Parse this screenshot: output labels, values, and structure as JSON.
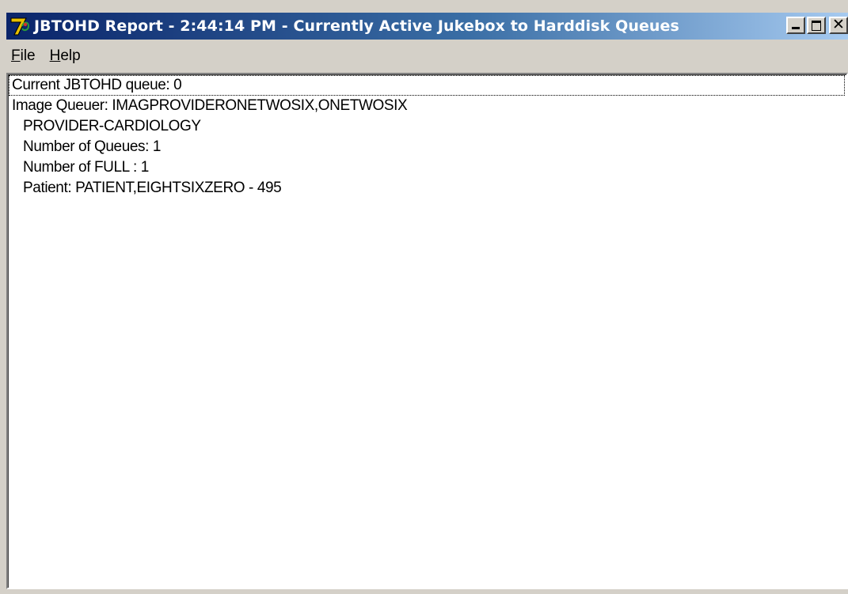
{
  "window": {
    "title": "JBTOHD Report - 2:44:14 PM - Currently Active Jukebox to Harddisk Queues",
    "icon": "app-7-icon",
    "controls": {
      "minimize": "minimize-icon",
      "maximize": "maximize-icon",
      "close_glyph": "✕"
    }
  },
  "menu": {
    "items": [
      {
        "label": "File",
        "mnemonic": "F",
        "rest": "ile"
      },
      {
        "label": "Help",
        "mnemonic": "H",
        "rest": "elp"
      }
    ]
  },
  "report": {
    "lines": [
      {
        "text": "Current JBTOHD queue: 0",
        "indent": false,
        "selected": true
      },
      {
        "text": "Image Queuer: IMAGPROVIDERONETWOSIX,ONETWOSIX",
        "indent": false,
        "selected": false
      },
      {
        "text": "PROVIDER-CARDIOLOGY",
        "indent": true,
        "selected": false
      },
      {
        "text": "Number of Queues: 1",
        "indent": true,
        "selected": false
      },
      {
        "text": "Number of FULL : 1",
        "indent": true,
        "selected": false
      },
      {
        "text": "Patient: PATIENT,EIGHTSIXZERO - 495",
        "indent": true,
        "selected": false
      }
    ]
  },
  "colors": {
    "titlebar_start": "#0a246a",
    "titlebar_end": "#a6caf0",
    "chrome": "#d4d0c8"
  }
}
